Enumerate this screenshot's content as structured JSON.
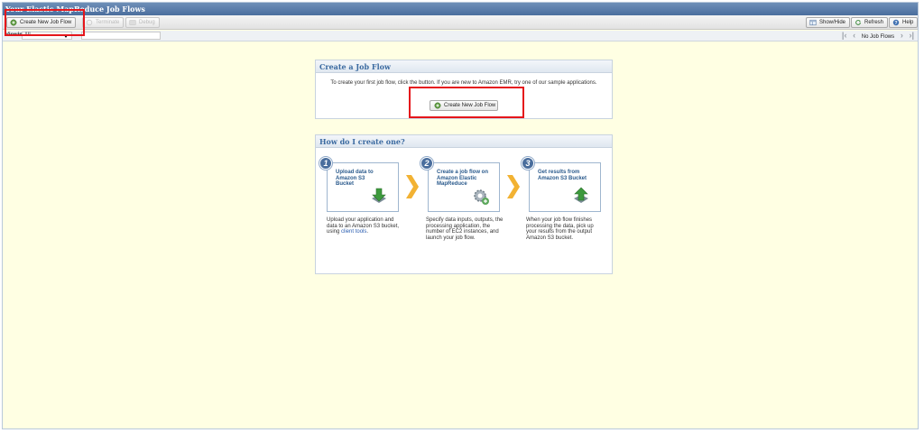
{
  "window": {
    "title": "Your Elastic MapReduce Job Flows"
  },
  "toolbar": {
    "create_label": "Create New Job Flow",
    "terminate_label": "Terminate",
    "debug_label": "Debug",
    "showhide_label": "Show/Hide",
    "refresh_label": "Refresh",
    "help_label": "Help"
  },
  "filter": {
    "viewing_label": "Viewing:",
    "viewing_value": "All",
    "search_value": ""
  },
  "pager": {
    "status": "No Job Flows"
  },
  "create_panel": {
    "title": "Create a Job Flow",
    "intro": "To create your first job flow, click the button. If you are new to Amazon EMR, try one of our sample applications.",
    "button_label": "Create New Job Flow"
  },
  "how_panel": {
    "title": "How do I create one?",
    "steps": [
      {
        "number": "1",
        "title": "Upload data to Amazon S3 Bucket",
        "icon": "upload-arrow-icon",
        "desc": "Upload your application and data to an Amazon S3 bucket, using",
        "link": "client tools",
        "desc_end": "."
      },
      {
        "number": "2",
        "title": "Create a job flow on Amazon Elastic MapReduce",
        "icon": "gears-icon",
        "desc": "Specify data inputs, outputs, the processing application, the number of EC2 instances, and launch your job flow."
      },
      {
        "number": "3",
        "title": "Get results from Amazon S3 Bucket",
        "icon": "download-arrow-icon",
        "desc": "When your job flow finishes processing the data, pick up your results from the output Amazon S3 bucket."
      }
    ]
  },
  "colors": {
    "highlight": "#e5161b",
    "background": "#ffffe3",
    "accent": "#3b6aa0"
  }
}
